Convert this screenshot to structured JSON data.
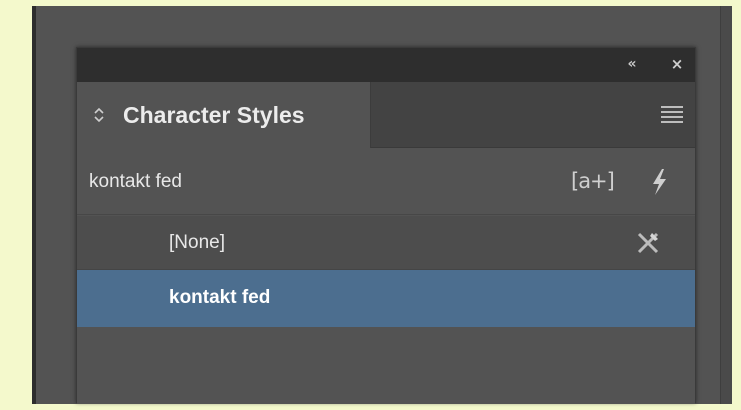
{
  "panel": {
    "collapse_icon": "«",
    "close_icon": "×",
    "tab": {
      "arrows_icon": "⬍",
      "label": "Character Styles"
    },
    "menu_icon": "panel-menu-icon"
  },
  "current_style": {
    "name": "kontakt fed",
    "new_style_label": "[a+]",
    "lightning_icon": "lightning-icon"
  },
  "styles": [
    {
      "label": "[None]",
      "selected": false,
      "icon": "clear-override-icon"
    },
    {
      "label": "kontakt fed",
      "selected": true
    }
  ],
  "colors": {
    "page_bg": "#f4f9cc",
    "panel_bg": "#535353",
    "topbar_bg": "#2e2e2e",
    "selection": "#4c6e8f"
  }
}
